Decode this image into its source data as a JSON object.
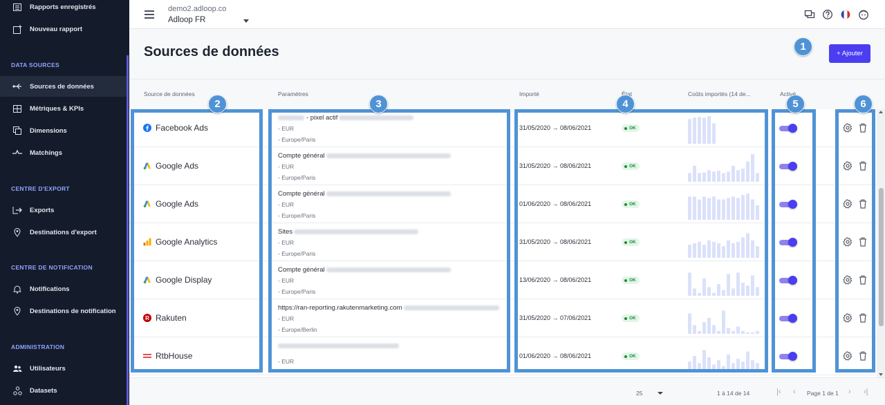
{
  "sidebar": {
    "top_items": [
      {
        "label": "Rapports enregistrés",
        "icon": "saved-reports-icon"
      },
      {
        "label": "Nouveau rapport",
        "icon": "new-report-icon"
      }
    ],
    "sections": [
      {
        "title": "DATA SOURCES",
        "items": [
          {
            "label": "Sources de données",
            "icon": "data-sources-icon",
            "active": true
          },
          {
            "label": "Métriques & KPIs",
            "icon": "metrics-icon"
          },
          {
            "label": "Dimensions",
            "icon": "dimensions-icon"
          },
          {
            "label": "Matchings",
            "icon": "matchings-icon"
          }
        ]
      },
      {
        "title": "CENTRE D'EXPORT",
        "items": [
          {
            "label": "Exports",
            "icon": "exports-icon"
          },
          {
            "label": "Destinations d'export",
            "icon": "location-pin-icon"
          }
        ]
      },
      {
        "title": "CENTRE DE NOTIFICATION",
        "items": [
          {
            "label": "Notifications",
            "icon": "bell-icon"
          },
          {
            "label": "Destinations de notification",
            "icon": "location-pin-icon"
          }
        ]
      },
      {
        "title": "ADMINISTRATION",
        "items": [
          {
            "label": "Utilisateurs",
            "icon": "users-icon"
          },
          {
            "label": "Datasets",
            "icon": "datasets-icon"
          }
        ]
      }
    ]
  },
  "header": {
    "account_url": "demo2.adloop.co",
    "account_name": "Adloop FR"
  },
  "page": {
    "title": "Sources de données",
    "add_button": "+ Ajouter"
  },
  "table": {
    "columns": {
      "source": "Source de données",
      "params": "Paramètres",
      "imported": "Importé",
      "state": "État",
      "costs": "Coûts importés (14 de...",
      "active": "Activé"
    },
    "rows": [
      {
        "source": "Facebook Ads",
        "logo": "facebook",
        "param_main": "- pixel actif",
        "param_lines": [
          "- EUR",
          "- Europe/Paris"
        ],
        "imported": "31/05/2020 → 08/06/2021",
        "state": "OK",
        "spark": [
          0.85,
          0.9,
          0.92,
          0.9,
          0.95,
          0.7,
          0,
          0,
          0,
          0,
          0,
          0,
          0,
          0
        ],
        "active": true
      },
      {
        "source": "Google Ads",
        "logo": "google-ads",
        "param_main": "Compte général",
        "param_lines": [
          "- EUR",
          "- Europe/Paris"
        ],
        "imported": "31/05/2020 → 08/06/2021",
        "state": "OK",
        "spark": [
          0.3,
          0.55,
          0.3,
          0.32,
          0.4,
          0.35,
          0.38,
          0.3,
          0.35,
          0.55,
          0.4,
          0.45,
          0.7,
          0.95,
          0.3
        ],
        "active": true
      },
      {
        "source": "Google Ads",
        "logo": "google-ads",
        "param_main": "Compte général",
        "param_lines": [
          "- EUR",
          "- Europe/Paris"
        ],
        "imported": "01/06/2020 → 08/06/2021",
        "state": "OK",
        "spark": [
          0.8,
          0.8,
          0.7,
          0.8,
          0.75,
          0.8,
          0.7,
          0.7,
          0.75,
          0.8,
          0.75,
          0.85,
          0.9,
          0.7,
          0.5
        ],
        "active": true
      },
      {
        "source": "Google Analytics",
        "logo": "google-analytics",
        "param_main": "Sites",
        "param_lines": [
          "- EUR",
          "- Europe/Paris"
        ],
        "imported": "31/05/2020 → 08/06/2021",
        "state": "OK",
        "spark": [
          0.45,
          0.5,
          0.55,
          0.45,
          0.6,
          0.55,
          0.5,
          0.4,
          0.6,
          0.5,
          0.55,
          0.7,
          0.85,
          0.6,
          0.4
        ],
        "active": true
      },
      {
        "source": "Google Display",
        "logo": "google-ads",
        "param_main": "Compte général",
        "param_lines": [
          "- EUR",
          "- Europe/Paris"
        ],
        "imported": "13/06/2020 → 08/06/2021",
        "state": "OK",
        "spark": [
          0.8,
          0.25,
          0.1,
          0.6,
          0.3,
          0.1,
          0.4,
          0.2,
          0.75,
          0.25,
          0.8,
          0.45,
          0.35,
          0.7,
          0.3
        ],
        "active": true
      },
      {
        "source": "Rakuten",
        "logo": "rakuten",
        "param_main": "https://ran-reporting.rakutenmarketing.com",
        "param_lines": [
          "- EUR",
          "- Europe/Berlin"
        ],
        "imported": "31/05/2020 → 07/06/2021",
        "state": "OK",
        "spark": [
          0.7,
          0.3,
          0.1,
          0.4,
          0.55,
          0.3,
          0.1,
          0.8,
          0.2,
          0.1,
          0.25,
          0.1,
          0.05,
          0.05,
          0.1
        ],
        "active": true
      },
      {
        "source": "RtbHouse",
        "logo": "rtbhouse",
        "param_main": "",
        "param_lines": [
          "- EUR"
        ],
        "imported": "01/06/2020 → 08/06/2021",
        "state": "OK",
        "spark": [
          0.35,
          0.55,
          0.3,
          0.75,
          0.5,
          0.25,
          0.4,
          0.2,
          0.6,
          0.3,
          0.45,
          0.35,
          0.7,
          0.4,
          0.3
        ],
        "active": true
      }
    ]
  },
  "footer": {
    "page_size": "25",
    "range": "1 à 14 de 14",
    "page_info": "Page 1 de 1"
  },
  "annotations": [
    "1",
    "2",
    "3",
    "4",
    "5",
    "6"
  ],
  "colors": {
    "accent": "#4b3ef0",
    "highlight": "#4f93d6",
    "sidebar_bg": "#141c2b",
    "ok": "#1d8a3d"
  }
}
